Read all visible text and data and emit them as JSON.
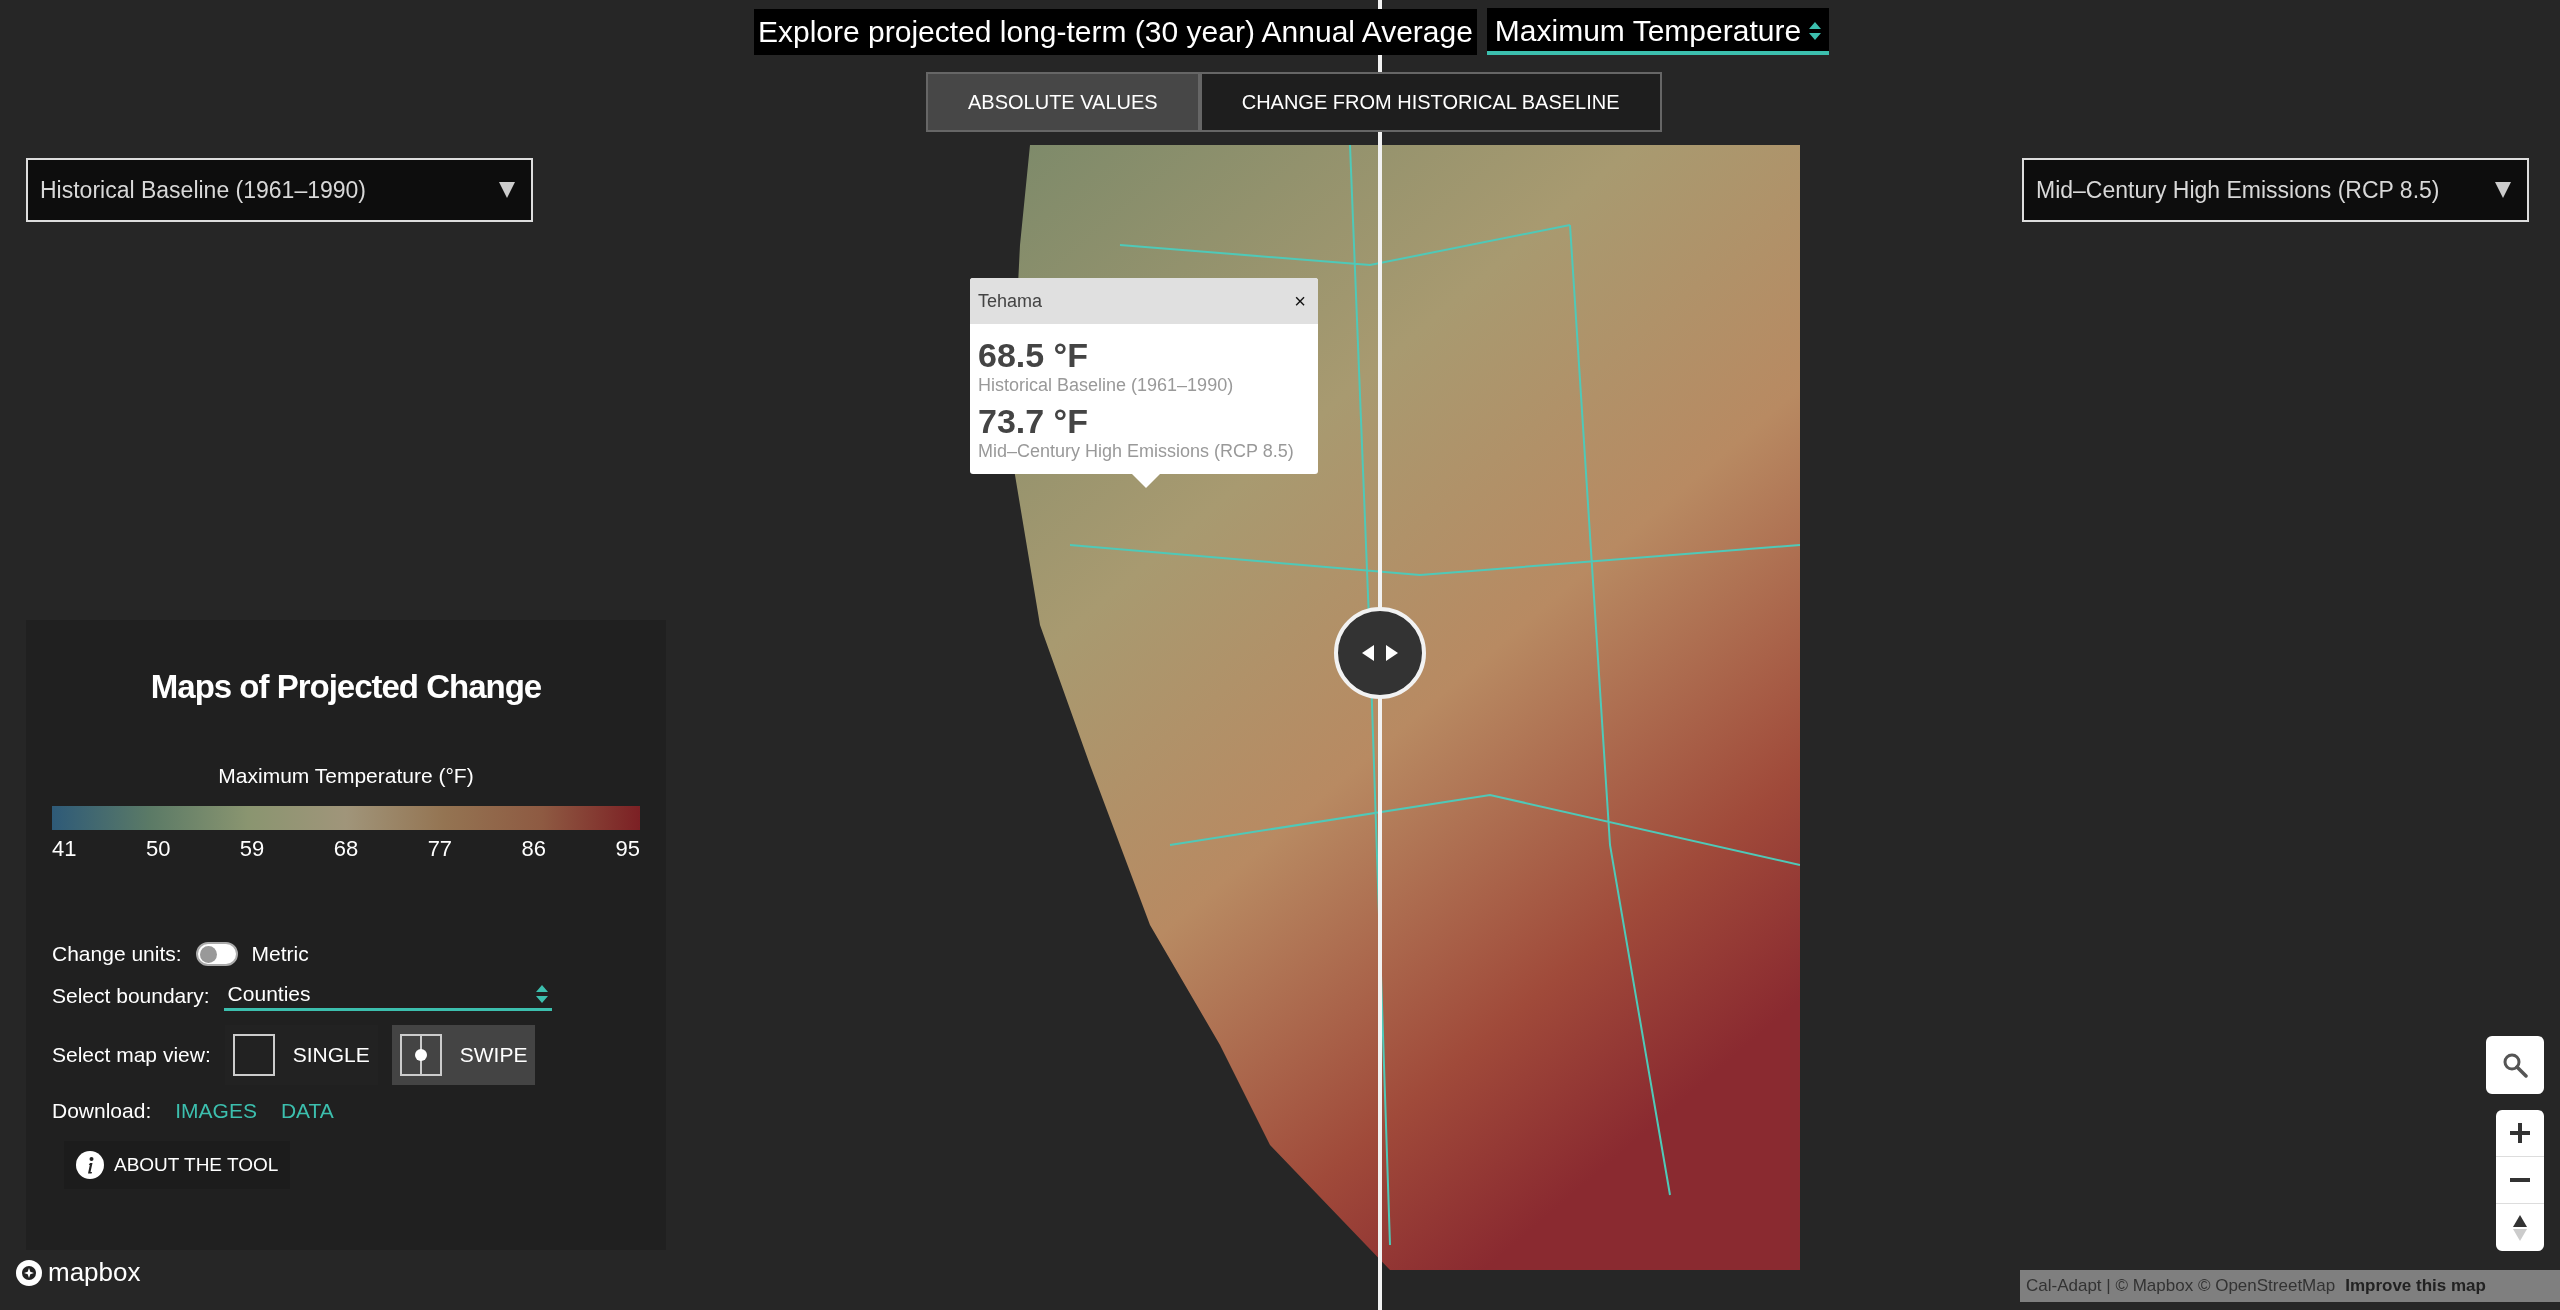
{
  "header": {
    "prefix": "Explore projected long-term (30 year) Annual Average",
    "variable": "Maximum Temperature"
  },
  "tabs": [
    {
      "label": "ABSOLUTE VALUES",
      "selected": true
    },
    {
      "label": "CHANGE FROM HISTORICAL BASELINE",
      "selected": false
    }
  ],
  "left_scenario": "Historical Baseline (1961–1990)",
  "right_scenario": "Mid–Century High Emissions (RCP 8.5)",
  "popup": {
    "title": "Tehama",
    "close": "×",
    "values": [
      {
        "value": "68.5 °F",
        "label": "Historical Baseline (1961–1990)"
      },
      {
        "value": "73.7 °F",
        "label": "Mid–Century High Emissions (RCP 8.5)"
      }
    ]
  },
  "panel": {
    "title": "Maps of Projected Change",
    "legend": {
      "title": "Maximum Temperature (°F)",
      "ticks": [
        "41",
        "50",
        "59",
        "68",
        "77",
        "86",
        "95"
      ]
    },
    "units": {
      "label": "Change units:",
      "on": false,
      "option": "Metric"
    },
    "boundary": {
      "label": "Select boundary:",
      "value": "Counties"
    },
    "map_view": {
      "label": "Select map view:",
      "options": [
        {
          "label": "SINGLE",
          "kind": "single",
          "selected": false
        },
        {
          "label": "SWIPE",
          "kind": "swipe",
          "selected": true
        }
      ]
    },
    "download": {
      "label": "Download:",
      "links": [
        "IMAGES",
        "DATA"
      ]
    },
    "about": "ABOUT THE TOOL"
  },
  "logo": "mapbox",
  "attribution": {
    "text": "Cal-Adapt | © Mapbox © OpenStreetMap",
    "link": "Improve this map"
  }
}
